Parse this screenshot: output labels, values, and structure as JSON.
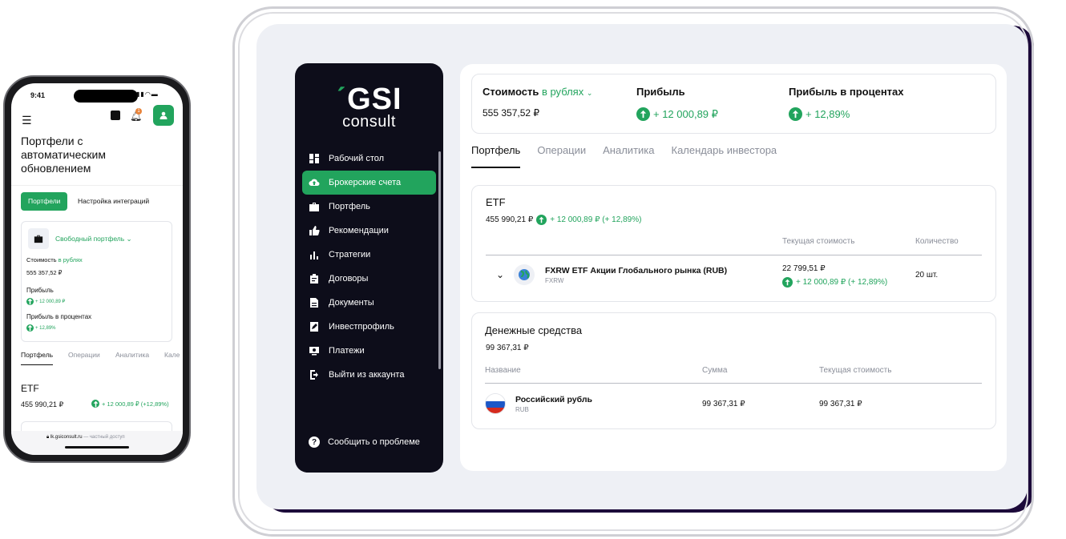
{
  "colors": {
    "accent": "#22a45d",
    "sidebar_bg": "#0d0d1a",
    "tablet_bg": "#eef0f5"
  },
  "brand": {
    "logo_top": "GSI",
    "logo_bottom": "consult"
  },
  "sidebar": {
    "items": [
      {
        "label": "Рабочий стол",
        "icon": "dashboard-icon",
        "active": false
      },
      {
        "label": "Брокерские счета",
        "icon": "cloud-upload-icon",
        "active": true
      },
      {
        "label": "Портфель",
        "icon": "briefcase-icon",
        "active": false
      },
      {
        "label": "Рекомендации",
        "icon": "thumbs-up-icon",
        "active": false
      },
      {
        "label": "Стратегии",
        "icon": "bar-chart-icon",
        "active": false
      },
      {
        "label": "Договоры",
        "icon": "clipboard-icon",
        "active": false
      },
      {
        "label": "Документы",
        "icon": "document-icon",
        "active": false
      },
      {
        "label": "Инвестпрофиль",
        "icon": "edit-document-icon",
        "active": false
      },
      {
        "label": "Платежи",
        "icon": "payment-icon",
        "active": false
      },
      {
        "label": "Выйти из аккаунта",
        "icon": "logout-icon",
        "active": false
      }
    ],
    "report": "Сообщить о проблеме"
  },
  "summary": {
    "cost_label": "Стоимость",
    "currency_selector": "в рублях",
    "cost_value": "555 357,52 ₽",
    "profit_label": "Прибыль",
    "profit_value": "+ 12 000,89 ₽",
    "profit_pct_label": "Прибыль в процентах",
    "profit_pct_value": "+ 12,89%"
  },
  "tabs": [
    "Портфель",
    "Операции",
    "Аналитика",
    "Календарь инвестора"
  ],
  "etf": {
    "title": "ETF",
    "total": "455 990,21 ₽",
    "change": "+ 12 000,89 ₽ (+ 12,89%)",
    "columns": [
      "Текущая стоимость",
      "Количество"
    ],
    "row": {
      "name": "FXRW ETF Акции Глобального рынка (RUB)",
      "ticker": "FXRW",
      "current_value": "22 799,51 ₽",
      "change": "+ 12 000,89 ₽ (+ 12,89%)",
      "quantity": "20 шт."
    }
  },
  "cash": {
    "title": "Денежные средства",
    "total": "99 367,31 ₽",
    "columns": [
      "Название",
      "Сумма",
      "Текущая стоимость"
    ],
    "row": {
      "name": "Российский рубль",
      "code": "RUB",
      "amount": "99 367,31 ₽",
      "current_value": "99 367,31 ₽"
    }
  },
  "phone": {
    "time": "9:41",
    "title": "Портфели с автоматическим обновлением",
    "btn_portfolios": "Портфели",
    "btn_integrations": "Настройка интеграций",
    "portfolio_name": "Свободный портфель",
    "cost_label": "Стоимость",
    "currency": "в рублях",
    "cost_value": "555 357,52 ₽",
    "profit_label": "Прибыль",
    "profit_value": "+ 12 000,89 ₽",
    "profit_pct_label": "Прибыль в процентах",
    "profit_pct_value": "+ 12,89%",
    "tabs": [
      "Портфель",
      "Операции",
      "Аналитика",
      "Кале"
    ],
    "etf_title": "ETF",
    "etf_total": "455 990,21 ₽",
    "etf_change": "+ 12 000,89 ₽ (+12,89%)",
    "url": "lk.gsiconsult.ru",
    "url_suffix": "— частный доступ",
    "notification_count": "1"
  }
}
